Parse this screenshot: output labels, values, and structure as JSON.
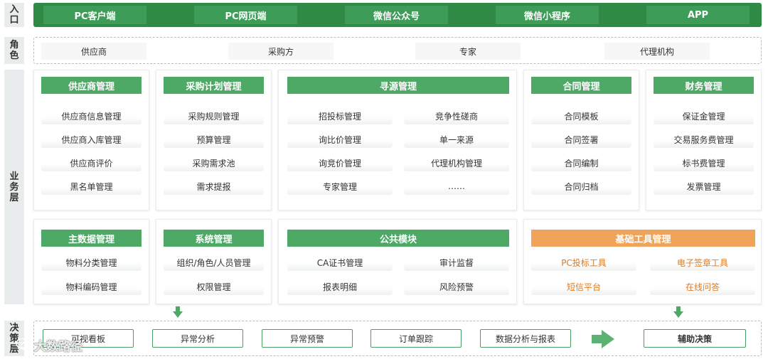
{
  "side_labels": {
    "entry": "入口",
    "role": "角色",
    "business": "业务层",
    "decision": "决策层"
  },
  "entries": [
    "PC客户端",
    "PC网页端",
    "微信公众号",
    "微信小程序",
    "APP"
  ],
  "roles": [
    "供应商",
    "采购方",
    "专家",
    "代理机构"
  ],
  "modules": {
    "supplier": {
      "title": "供应商管理",
      "items": [
        "供应商信息管理",
        "供应商入库管理",
        "供应商评价",
        "黑名单管理"
      ]
    },
    "procurement_plan": {
      "title": "采购计划管理",
      "items": [
        "采购规则管理",
        "预算管理",
        "采购需求池",
        "需求提报"
      ]
    },
    "sourcing": {
      "title": "寻源管理",
      "left": [
        "招投标管理",
        "询比价管理",
        "询竞价管理",
        "专家管理"
      ],
      "right": [
        "竞争性磋商",
        "单一来源",
        "代理机构管理",
        "……"
      ]
    },
    "contract": {
      "title": "合同管理",
      "items": [
        "合同模板",
        "合同签署",
        "合同编制",
        "合同归档"
      ]
    },
    "finance": {
      "title": "财务管理",
      "items": [
        "保证金管理",
        "交易服务费管理",
        "标书费管理",
        "发票管理"
      ]
    },
    "master_data": {
      "title": "主数据管理",
      "items": [
        "物料分类管理",
        "物料编码管理"
      ]
    },
    "system": {
      "title": "系统管理",
      "items": [
        "组织/角色/人员管理",
        "权限管理"
      ]
    },
    "public": {
      "title": "公共模块",
      "left": [
        "CA证书管理",
        "报表明细"
      ],
      "right": [
        "审计监督",
        "风险预警"
      ]
    },
    "tools": {
      "title": "基础工具管理",
      "left": [
        "PC投标工具",
        "短信平台"
      ],
      "right": [
        "电子签章工具",
        "在线问答"
      ]
    }
  },
  "decision": {
    "items": [
      "可视看板",
      "异常分析",
      "异常预警",
      "订单跟踪",
      "数据分析与报表"
    ],
    "result": "辅助决策"
  },
  "watermark": "大数路径",
  "colors": {
    "primary_green": "#2f8a46",
    "header_green": "#4ea866",
    "accent_orange": "#f0a45a",
    "orange_text": "#e07a1f"
  }
}
